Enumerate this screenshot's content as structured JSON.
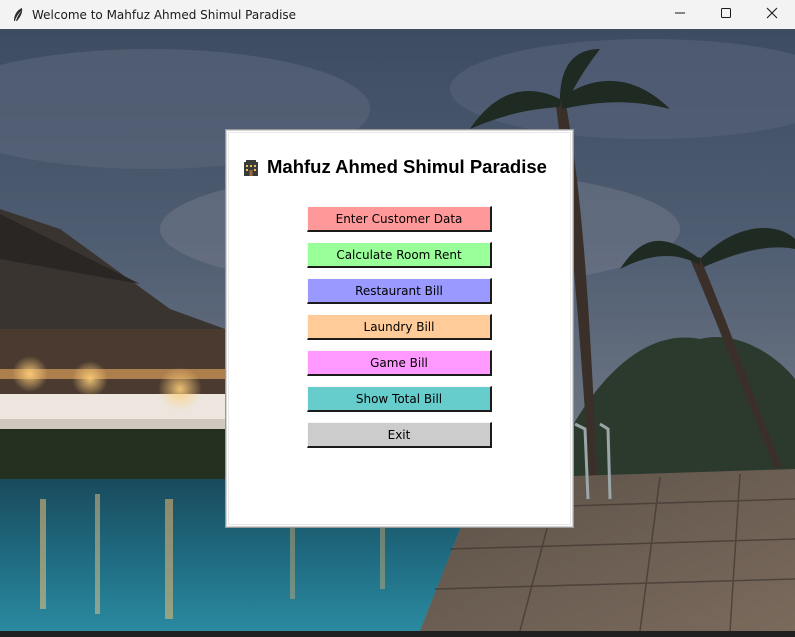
{
  "window": {
    "title": "Welcome to Mahfuz Ahmed Shimul Paradise",
    "app_icon": "feather-icon",
    "controls": [
      "minimize-icon",
      "maximize-icon",
      "close-icon"
    ]
  },
  "panel": {
    "heading_icon": "hotel-icon",
    "heading": "Mahfuz Ahmed Shimul Paradise",
    "buttons": [
      {
        "label": "Enter Customer Data",
        "color": "#ff9999"
      },
      {
        "label": "Calculate Room Rent",
        "color": "#99ff99"
      },
      {
        "label": "Restaurant Bill",
        "color": "#9999ff"
      },
      {
        "label": "Laundry Bill",
        "color": "#ffcc99"
      },
      {
        "label": "Game Bill",
        "color": "#ff99ff"
      },
      {
        "label": "Show Total Bill",
        "color": "#66cccc"
      },
      {
        "label": "Exit",
        "color": "#cccccc"
      }
    ]
  }
}
